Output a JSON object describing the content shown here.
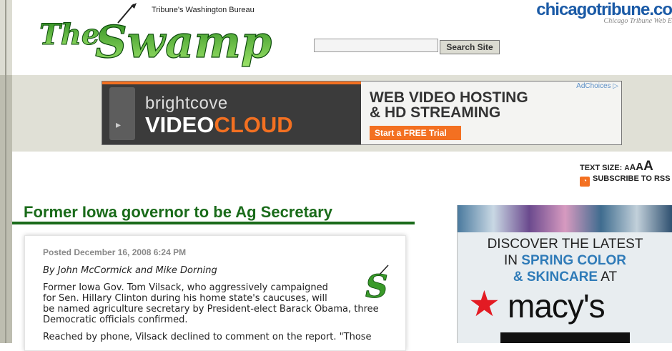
{
  "header": {
    "bureau": "Tribune's Washington Bureau",
    "logo_text": "The Swamp",
    "site_name": "chicagotribune.co",
    "site_sub": "Chicago Tribune Web E"
  },
  "search": {
    "value": "",
    "button_label": "Search Site"
  },
  "ad_banner": {
    "adchoices": "AdChoices",
    "brand_top": "brightcove",
    "brand_video": "VIDEO",
    "brand_cloud": "CLOUD",
    "headline1": "WEB VIDEO HOSTING",
    "headline2": "& HD STREAMING",
    "cta": "Start a FREE Trial"
  },
  "tools": {
    "text_size_label": "TEXT SIZE:",
    "sizes": [
      "A",
      "A",
      "A",
      "A"
    ],
    "subscribe": "SUBSCRIBE TO RSS"
  },
  "article": {
    "title": "Former Iowa governor to be Ag Secretary",
    "posted": "Posted December 16, 2008 6:24 PM",
    "byline": "By John McCormick and Mike Dorning",
    "para1_lines": [
      "Former Iowa Gov. Tom Vilsack, who aggressively campaigned",
      "for Sen. Hillary Clinton during his home state's caucuses, will",
      "be named agriculture secretary by President-elect Barack Obama, three",
      "Democratic officials confirmed."
    ],
    "para2": "Reached by phone, Vilsack declined to comment on the report. \"Those"
  },
  "side_ad": {
    "line1": "DISCOVER THE LATEST",
    "line2_pre": "IN ",
    "line2_em": "SPRING COLOR",
    "line3_em": "& SKINCARE",
    "line3_post": " AT",
    "brand": "macy's"
  }
}
